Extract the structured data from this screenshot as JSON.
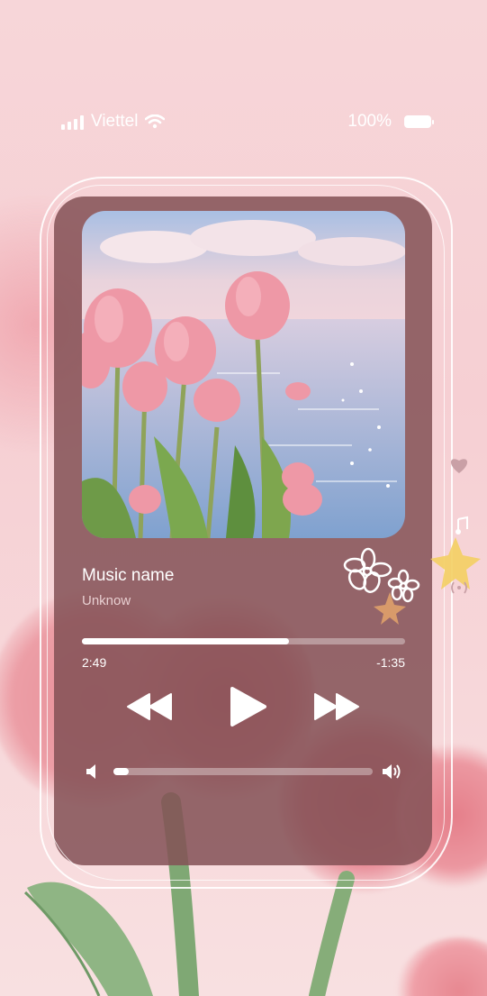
{
  "status_bar": {
    "carrier": "Viettel",
    "battery": "100%",
    "icons": [
      "signal-icon",
      "wifi-icon",
      "battery-icon"
    ]
  },
  "player": {
    "song_title": "Music name",
    "artist": "Unknow",
    "time_elapsed": "2:49",
    "time_remaining": "-1:35",
    "progress_fraction": 0.64,
    "volume_fraction": 0.06,
    "controls": [
      "rewind-icon",
      "play-icon",
      "fast-forward-icon"
    ],
    "volume_icons": [
      "volume-low-icon",
      "volume-high-icon"
    ]
  },
  "decorations": [
    "flower-doodle",
    "heart-icon",
    "music-note-icon",
    "star-sticker"
  ],
  "colors": {
    "background": "#f7d6d9",
    "card": "#845256",
    "text_primary": "#ffffff",
    "text_secondary": "#e8cfd1"
  }
}
